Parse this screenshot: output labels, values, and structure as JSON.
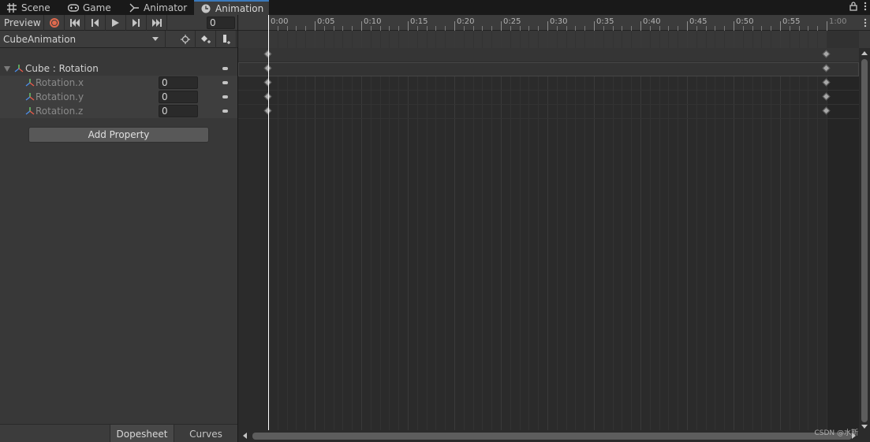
{
  "tabs": [
    {
      "label": "Scene",
      "icon": "grid-icon"
    },
    {
      "label": "Game",
      "icon": "gamepad-icon"
    },
    {
      "label": "Animator",
      "icon": "animator-icon"
    },
    {
      "label": "Animation",
      "icon": "clock-icon",
      "active": true
    }
  ],
  "toolbar": {
    "preview_label": "Preview",
    "frame_value": "0",
    "clip_name": "CubeAnimation"
  },
  "properties": {
    "group_label": "Cube : Rotation",
    "children": [
      {
        "label": "Rotation.x",
        "value": "0"
      },
      {
        "label": "Rotation.y",
        "value": "0"
      },
      {
        "label": "Rotation.z",
        "value": "0"
      }
    ]
  },
  "add_property_label": "Add Property",
  "bottom_tabs": {
    "dopesheet": "Dopesheet",
    "curves": "Curves"
  },
  "timeline": {
    "ticks": [
      "0:00",
      "0:05",
      "0:10",
      "0:15",
      "0:20",
      "0:25",
      "0:30",
      "0:35",
      "0:40",
      "0:45",
      "0:50",
      "0:55",
      "1:00"
    ],
    "keyframe_times": [
      "0:00",
      "1:00"
    ]
  },
  "watermark": "CSDN @水斯",
  "colors": {
    "record": "#e06a4e",
    "active_tab_accent": "#3a79bb",
    "playhead": "#ffffff"
  }
}
